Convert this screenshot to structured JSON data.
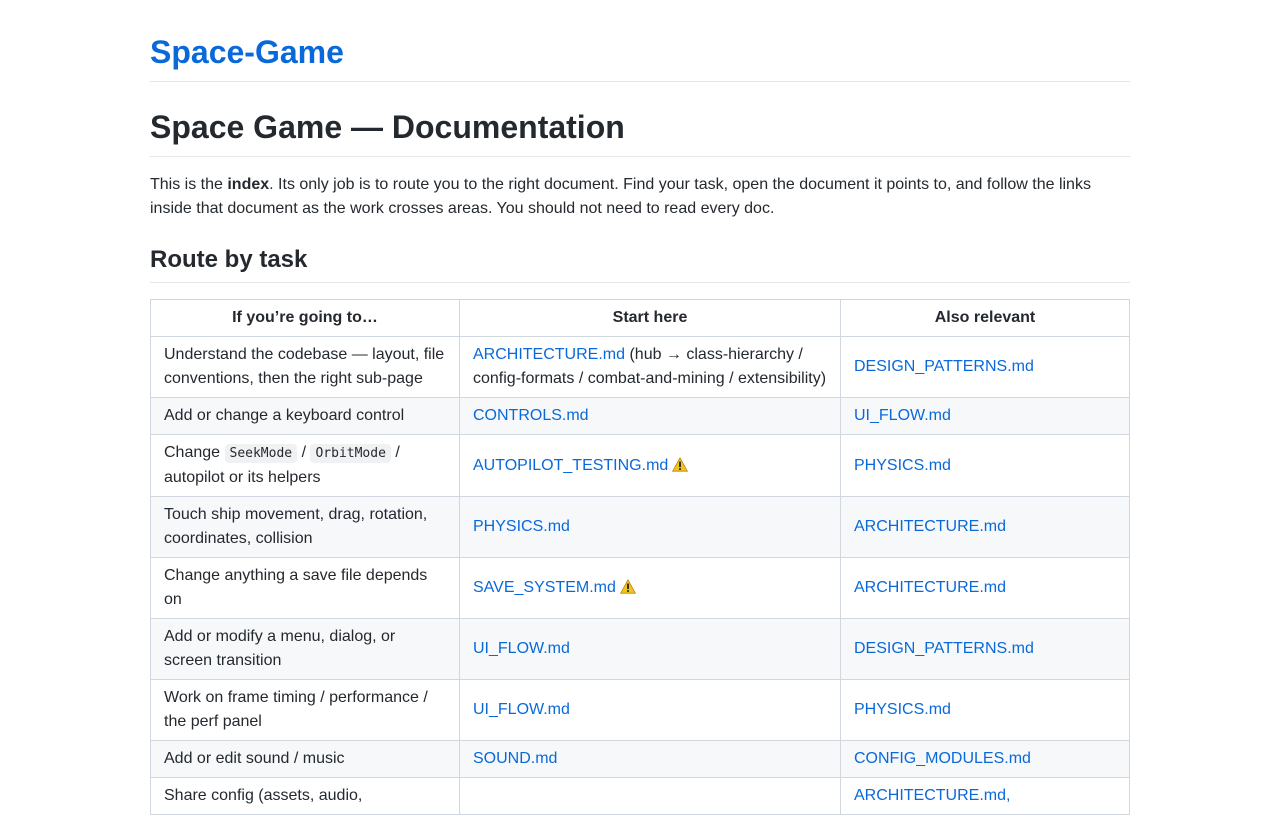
{
  "site": {
    "title": "Space-Game"
  },
  "page": {
    "title": "Space Game — Documentation",
    "intro": {
      "before": "This is the ",
      "bold": "index",
      "after": ". Its only job is to route you to the right document. Find your task, open the document it points to, and follow the links inside that document as the work crosses areas. You should not need to read every doc."
    }
  },
  "section": {
    "heading": "Route by task"
  },
  "table": {
    "headers": [
      "If you’re going to…",
      "Start here",
      "Also relevant"
    ],
    "rows": [
      {
        "task": "Understand the codebase — layout, file conventions, then the right sub-page",
        "start": "ARCHITECTURE.md",
        "start_note": " (hub → class-hierarchy / config-formats / combat-and-mining / extensibility)",
        "also": "DESIGN_PATTERNS.md"
      },
      {
        "task": "Add or change a keyboard control",
        "start": "CONTROLS.md",
        "also": "UI_FLOW.md"
      },
      {
        "task_pre": "Change ",
        "code1": "SeekMode",
        "task_mid": " / ",
        "code2": "OrbitMode",
        "task_post": " / autopilot or its helpers",
        "start": "AUTOPILOT_TESTING.md",
        "warn": "warning-icon",
        "also": "PHYSICS.md"
      },
      {
        "task": "Touch ship movement, drag, rotation, coordinates, collision",
        "start": "PHYSICS.md",
        "also": "ARCHITECTURE.md"
      },
      {
        "task": "Change anything a save file depends on",
        "start": "SAVE_SYSTEM.md",
        "warn": "warning-icon",
        "also": "ARCHITECTURE.md"
      },
      {
        "task": "Add or modify a menu, dialog, or screen transition",
        "start": "UI_FLOW.md",
        "also": "DESIGN_PATTERNS.md"
      },
      {
        "task": "Work on frame timing / performance / the perf panel",
        "start": "UI_FLOW.md",
        "also": "PHYSICS.md"
      },
      {
        "task": "Add or edit sound / music",
        "start": "SOUND.md",
        "also": "CONFIG_MODULES.md"
      },
      {
        "task": "Share config (assets, audio,",
        "start": "",
        "also": "ARCHITECTURE.md,"
      }
    ]
  },
  "colors": {
    "link": "#0969da",
    "text": "#24292f",
    "border": "#d0d7de",
    "stripe": "#f6f8fa"
  }
}
